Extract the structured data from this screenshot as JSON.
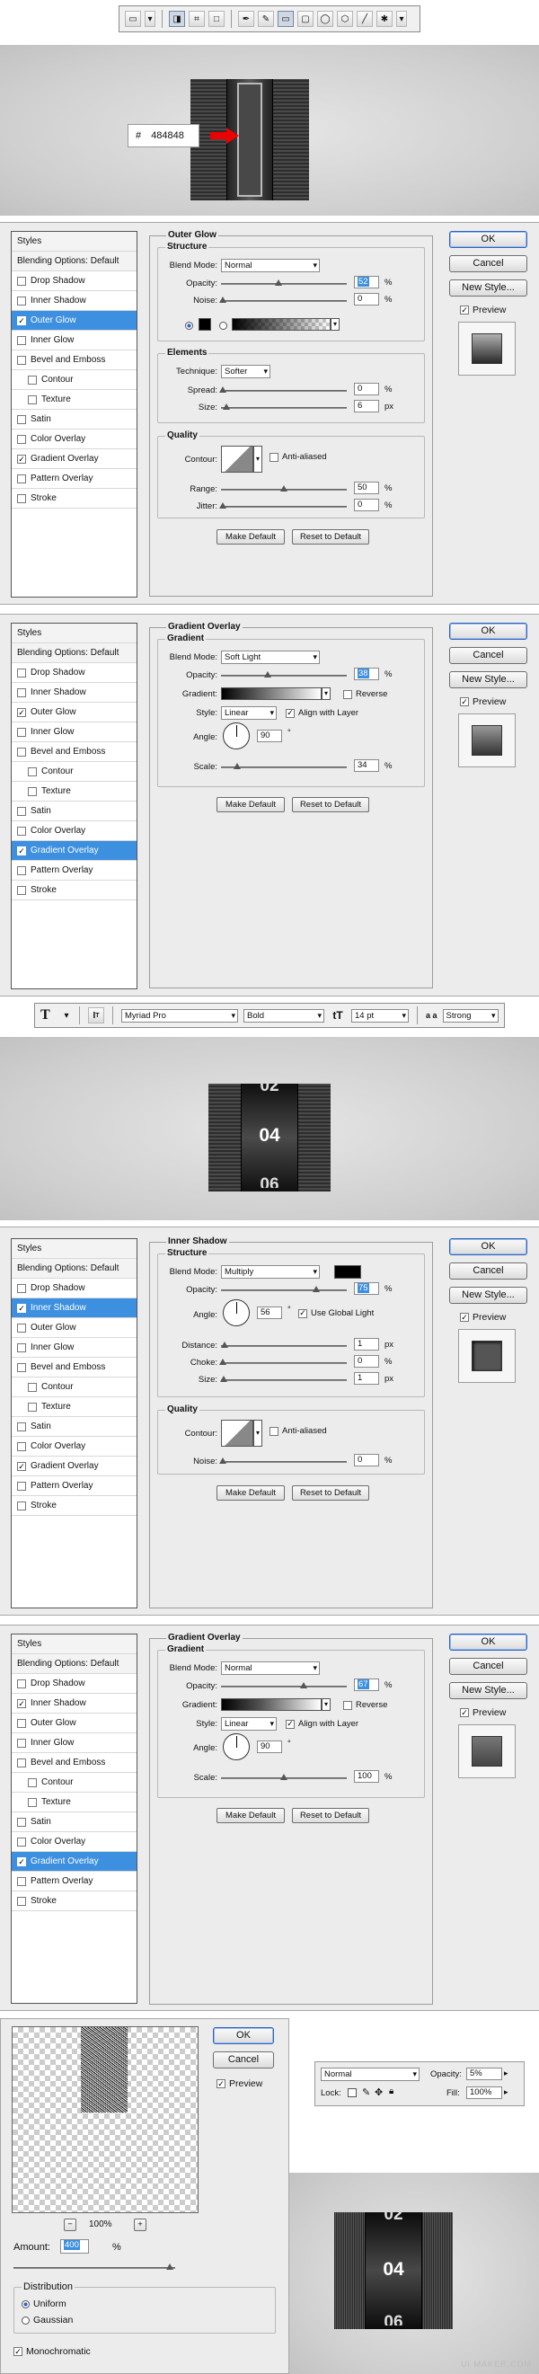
{
  "watermark": "UI MAKER.COM",
  "color_tag": {
    "hash": "#",
    "value": "484848"
  },
  "dialog1": {
    "title": "Outer Glow",
    "styles": {
      "header": "Styles",
      "blending": "Blending Options: Default",
      "drop_shadow": "Drop Shadow",
      "inner_shadow": "Inner Shadow",
      "outer_glow": "Outer Glow",
      "inner_glow": "Inner Glow",
      "bevel": "Bevel and Emboss",
      "contour": "Contour",
      "texture": "Texture",
      "satin": "Satin",
      "color_overlay": "Color Overlay",
      "gradient_overlay": "Gradient Overlay",
      "pattern_overlay": "Pattern Overlay",
      "stroke": "Stroke"
    },
    "structure": {
      "label": "Structure",
      "blend_mode_label": "Blend Mode:",
      "blend_mode": "Normal",
      "opacity_label": "Opacity:",
      "opacity": "52",
      "noise_label": "Noise:",
      "noise": "0",
      "pct": "%"
    },
    "elements": {
      "label": "Elements",
      "technique_label": "Technique:",
      "technique": "Softer",
      "spread_label": "Spread:",
      "spread": "0",
      "size_label": "Size:",
      "size": "6",
      "px": "px",
      "pct": "%"
    },
    "quality": {
      "label": "Quality",
      "contour_label": "Contour:",
      "anti_aliased": "Anti-aliased",
      "range_label": "Range:",
      "range": "50",
      "jitter_label": "Jitter:",
      "jitter": "0",
      "pct": "%"
    },
    "make_default": "Make Default",
    "reset_default": "Reset to Default",
    "ok": "OK",
    "cancel": "Cancel",
    "new_style": "New Style...",
    "preview": "Preview"
  },
  "dialog2": {
    "title": "Gradient Overlay",
    "styles": {
      "header": "Styles",
      "blending": "Blending Options: Default",
      "drop_shadow": "Drop Shadow",
      "inner_shadow": "Inner Shadow",
      "outer_glow": "Outer Glow",
      "inner_glow": "Inner Glow",
      "bevel": "Bevel and Emboss",
      "contour": "Contour",
      "texture": "Texture",
      "satin": "Satin",
      "color_overlay": "Color Overlay",
      "gradient_overlay": "Gradient Overlay",
      "pattern_overlay": "Pattern Overlay",
      "stroke": "Stroke"
    },
    "gradient": {
      "label": "Gradient",
      "blend_mode_label": "Blend Mode:",
      "blend_mode": "Soft Light",
      "opacity_label": "Opacity:",
      "opacity": "38",
      "pct": "%",
      "gradient_label": "Gradient:",
      "reverse": "Reverse",
      "style_label": "Style:",
      "style": "Linear",
      "align": "Align with Layer",
      "angle_label": "Angle:",
      "angle": "90",
      "deg": "°",
      "scale_label": "Scale:",
      "scale": "34"
    },
    "make_default": "Make Default",
    "reset_default": "Reset to Default",
    "ok": "OK",
    "cancel": "Cancel",
    "new_style": "New Style...",
    "preview": "Preview"
  },
  "char_bar": {
    "font": "Myriad Pro",
    "style": "Bold",
    "size": "14 pt",
    "aa_label": "a a",
    "aa": "Strong"
  },
  "digits1": {
    "top": "02",
    "mid": "04",
    "bottom": "06"
  },
  "dialog3": {
    "title": "Inner Shadow",
    "styles": {
      "header": "Styles",
      "blending": "Blending Options: Default",
      "drop_shadow": "Drop Shadow",
      "inner_shadow": "Inner Shadow",
      "outer_glow": "Outer Glow",
      "inner_glow": "Inner Glow",
      "bevel": "Bevel and Emboss",
      "contour": "Contour",
      "texture": "Texture",
      "satin": "Satin",
      "color_overlay": "Color Overlay",
      "gradient_overlay": "Gradient Overlay",
      "pattern_overlay": "Pattern Overlay",
      "stroke": "Stroke"
    },
    "structure": {
      "label": "Structure",
      "blend_mode_label": "Blend Mode:",
      "blend_mode": "Multiply",
      "opacity_label": "Opacity:",
      "opacity": "75",
      "pct": "%",
      "angle_label": "Angle:",
      "angle": "56",
      "deg": "°",
      "global_light": "Use Global Light",
      "distance_label": "Distance:",
      "distance": "1",
      "choke_label": "Choke:",
      "choke": "0",
      "size_label": "Size:",
      "size": "1",
      "px": "px"
    },
    "quality": {
      "label": "Quality",
      "contour_label": "Contour:",
      "anti_aliased": "Anti-aliased",
      "noise_label": "Noise:",
      "noise": "0",
      "pct": "%"
    },
    "make_default": "Make Default",
    "reset_default": "Reset to Default",
    "ok": "OK",
    "cancel": "Cancel",
    "new_style": "New Style...",
    "preview": "Preview"
  },
  "dialog4": {
    "title": "Gradient Overlay",
    "styles": {
      "header": "Styles",
      "blending": "Blending Options: Default",
      "drop_shadow": "Drop Shadow",
      "inner_shadow": "Inner Shadow",
      "outer_glow": "Outer Glow",
      "inner_glow": "Inner Glow",
      "bevel": "Bevel and Emboss",
      "contour": "Contour",
      "texture": "Texture",
      "satin": "Satin",
      "color_overlay": "Color Overlay",
      "gradient_overlay": "Gradient Overlay",
      "pattern_overlay": "Pattern Overlay",
      "stroke": "Stroke"
    },
    "gradient": {
      "label": "Gradient",
      "blend_mode_label": "Blend Mode:",
      "blend_mode": "Normal",
      "opacity_label": "Opacity:",
      "opacity": "67",
      "pct": "%",
      "gradient_label": "Gradient:",
      "reverse": "Reverse",
      "style_label": "Style:",
      "style": "Linear",
      "align": "Align with Layer",
      "angle_label": "Angle:",
      "angle": "90",
      "deg": "°",
      "scale_label": "Scale:",
      "scale": "100"
    },
    "make_default": "Make Default",
    "reset_default": "Reset to Default",
    "ok": "OK",
    "cancel": "Cancel",
    "new_style": "New Style...",
    "preview": "Preview"
  },
  "add_noise": {
    "zoom": "100%",
    "minus": "−",
    "plus": "+",
    "amount_label": "Amount:",
    "amount": "400",
    "pct": "%",
    "distribution": "Distribution",
    "uniform": "Uniform",
    "gaussian": "Gaussian",
    "monochromatic": "Monochromatic",
    "ok": "OK",
    "cancel": "Cancel",
    "preview": "Preview"
  },
  "layers": {
    "blend": "Normal",
    "opacity_label": "Opacity:",
    "opacity": "5%",
    "lock_label": "Lock:",
    "fill_label": "Fill:",
    "fill": "100%"
  },
  "digits2": {
    "top": "02",
    "mid": "04",
    "bottom": "06"
  }
}
